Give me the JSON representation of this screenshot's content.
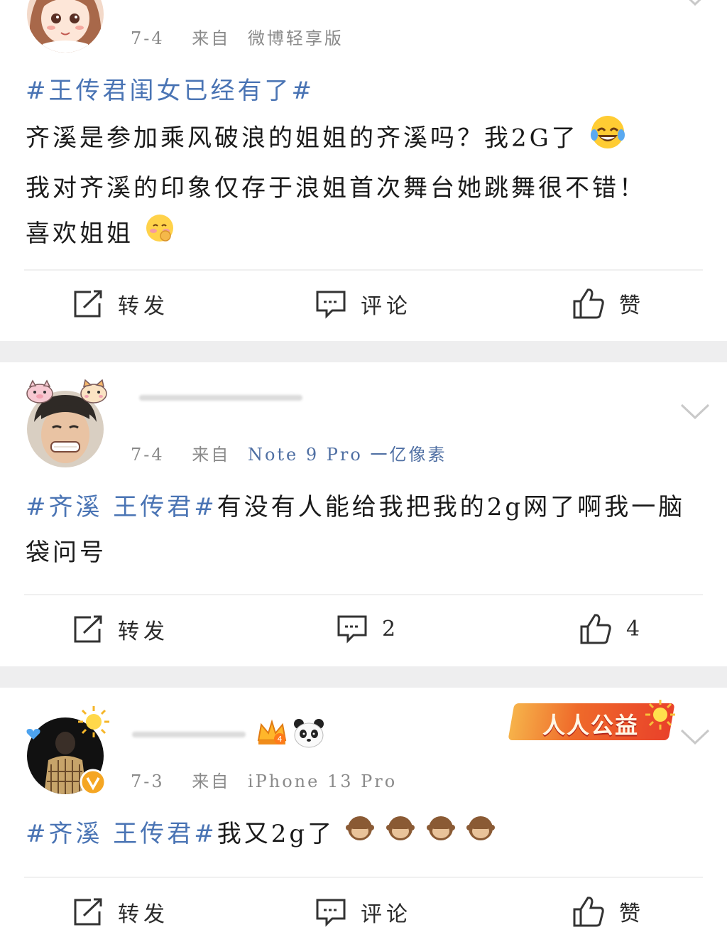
{
  "posts": [
    {
      "date": "7-4",
      "source_label": "来自",
      "device": "微博轻享版",
      "hashtag": "#王传君闺女已经有了#",
      "lines": [
        "齐溪是参加乘风破浪的姐姐的齐溪吗？我2G了",
        "我对齐溪的印象仅存于浪姐首次舞台她跳舞很不错！",
        "喜欢姐姐"
      ],
      "actions": {
        "repost": "转发",
        "comment": "评论",
        "like": "赞"
      },
      "icons": [
        "laughing-crying-emoji",
        "shy-emoji"
      ]
    },
    {
      "date": "7-4",
      "source_label": "来自",
      "device": "Note 9 Pro 一亿像素",
      "hashtag": "#齐溪 王传君#",
      "text": "有没有人能给我把我的2g网了啊我一脑袋问号",
      "actions": {
        "repost": "转发",
        "comment": "2",
        "like": "4"
      }
    },
    {
      "date": "7-3",
      "source_label": "来自",
      "device": "iPhone 13 Pro",
      "hashtag": "#齐溪 王传君#",
      "text": "我又2g了",
      "badge": "人人公益",
      "actions": {
        "repost": "转发",
        "comment": "评论",
        "like": "赞"
      },
      "icons": [
        "crown-icon",
        "panda-icon",
        "verified-badge-icon",
        "monkey-emoji"
      ]
    }
  ],
  "colors": {
    "hashtag": "#4a74b4",
    "meta": "#8a8a8a",
    "separator": "#eeeeef"
  }
}
